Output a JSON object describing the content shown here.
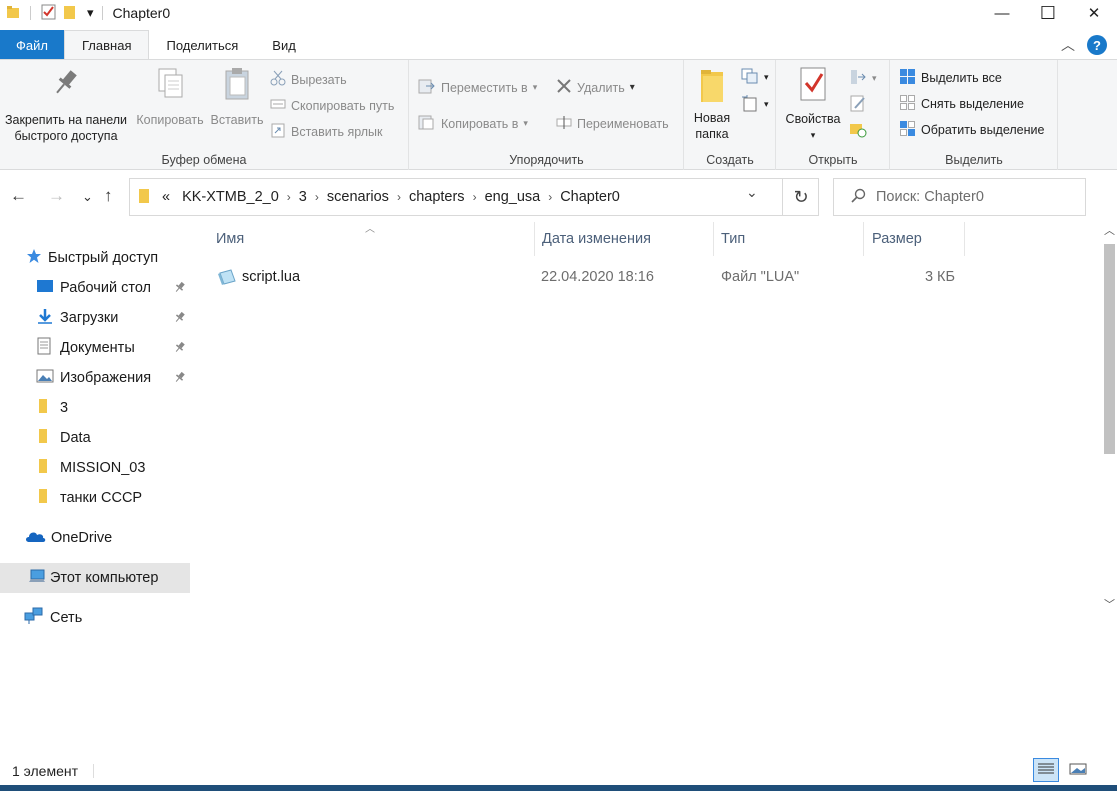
{
  "window": {
    "title": "Chapter0",
    "minimize_glyph": "—",
    "maximize_glyph": "☐",
    "close_glyph": "✕"
  },
  "qat": {
    "dropdown_glyph": "▾"
  },
  "tabs": [
    {
      "label": "Файл",
      "kind": "file"
    },
    {
      "label": "Главная",
      "kind": "active"
    },
    {
      "label": "Поделиться",
      "kind": "normal"
    },
    {
      "label": "Вид",
      "kind": "normal"
    }
  ],
  "ribbon_collapse_glyph": "︿",
  "help_glyph": "?",
  "ribbon": {
    "clipboard": {
      "label": "Буфер обмена",
      "pin": {
        "line1": "Закрепить на панели",
        "line2": "быстрого доступа"
      },
      "copy": "Копировать",
      "paste": "Вставить",
      "cut": "Вырезать",
      "copy_path": "Скопировать путь",
      "paste_shortcut": "Вставить ярлык"
    },
    "organize": {
      "label": "Упорядочить",
      "move_to": "Переместить в",
      "copy_to": "Копировать в",
      "delete": "Удалить",
      "rename": "Переименовать"
    },
    "new": {
      "label": "Создать",
      "new_folder": {
        "line1": "Новая",
        "line2": "папка"
      }
    },
    "open": {
      "label": "Открыть",
      "properties": "Свойства"
    },
    "select": {
      "label": "Выделить",
      "select_all": "Выделить все",
      "select_none": "Снять выделение",
      "invert": "Обратить выделение"
    }
  },
  "address": {
    "overflow": "«",
    "crumbs": [
      "KK-XTMB_2_0",
      "3",
      "scenarios",
      "chapters",
      "eng_usa",
      "Chapter0"
    ],
    "separator": "›",
    "search_placeholder": "Поиск: Chapter0"
  },
  "nav": {
    "quick_access": "Быстрый доступ",
    "desktop": "Рабочий стол",
    "downloads": "Загрузки",
    "documents": "Документы",
    "pictures": "Изображения",
    "folder_3": "3",
    "folder_data": "Data",
    "folder_mission": "MISSION_03",
    "folder_tanks": "танки СССР",
    "onedrive": "OneDrive",
    "this_pc": "Этот компьютер",
    "network": "Сеть"
  },
  "columns": {
    "name": "Имя",
    "date": "Дата изменения",
    "type": "Тип",
    "size": "Размер"
  },
  "files": [
    {
      "name": "script.lua",
      "date": "22.04.2020 18:16",
      "type": "Файл \"LUA\"",
      "size": "3 КБ"
    }
  ],
  "status": {
    "count": "1 элемент"
  },
  "colors": {
    "accent": "#1979ca",
    "folder": "#f2c84b",
    "selected_nav": "#e5e5e5"
  }
}
